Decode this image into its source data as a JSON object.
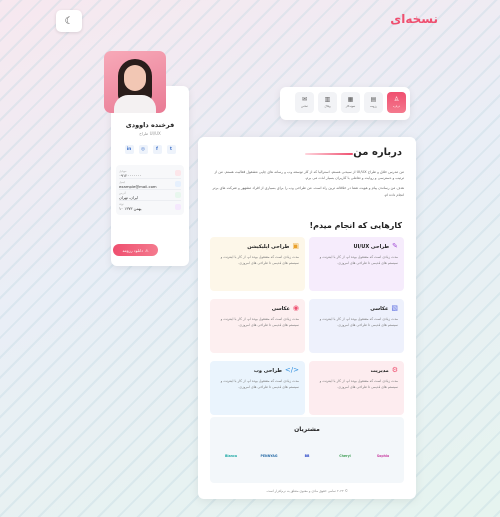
{
  "brand": {
    "logo_text": "نسخه‌ای",
    "accent": "#ef4f6f"
  },
  "theme_toggle": {
    "icon": "moon-icon"
  },
  "profile": {
    "name": "فرخنده داوودی",
    "title": "طراح UI/UX",
    "socials": [
      "in",
      "◎",
      "f",
      "t"
    ],
    "contacts": [
      {
        "label": "موبایل",
        "value": "۰۹۱۲۰۰۰۰۰۰۰"
      },
      {
        "label": "ایمیل",
        "value": "example@mail.com"
      },
      {
        "label": "آدرس",
        "value": "ایران، تهران"
      },
      {
        "label": "تولد",
        "value": "۱۰ بهمن ۱۳۷۳"
      }
    ],
    "download_label": "دانلود رزومه"
  },
  "nav": {
    "tabs": [
      {
        "label": "درباره",
        "icon": "user-icon",
        "active": true
      },
      {
        "label": "رزومه",
        "icon": "file-icon",
        "active": false
      },
      {
        "label": "نمونه‌کار",
        "icon": "briefcase-icon",
        "active": false
      },
      {
        "label": "وبلاگ",
        "icon": "blog-icon",
        "active": false
      },
      {
        "label": "تماس",
        "icon": "mail-icon",
        "active": false
      }
    ]
  },
  "about": {
    "title": "درباره من",
    "paragraphs": [
      "من مدرس خلاق و طراح UI/UX از سیدنی هستم. استرالیا که از کار توسعه وب و رسانه های چاپی مشغول فعالیت هستم. من از ترتیب و دسترسی و روایت و تعاملی با کاربران بسیار لذت می برم.",
      "هدف من رساندن پیام و هویت شما در خلاقانه ترین راه است. من طراحی وب را برای بسیاری از افراد مشهور و شرکت های برتر انجام داده ام."
    ]
  },
  "services": {
    "title": "کارهایی که انجام میدم!",
    "items": [
      {
        "name": "طراحی UI/UX",
        "icon": "✎",
        "bg": "#f6ecfc",
        "color": "#a34fd6",
        "desc": "مدت زیادی است که مشغول بوده ام، از کار با اینترنت و سیستم های قدیمی تا طراحی های امروزی."
      },
      {
        "name": "طراحی اپلیکیشن",
        "icon": "▣",
        "bg": "#fdf7e9",
        "color": "#e9a12b",
        "desc": "مدت زیادی است که مشغول بوده ام، از کار با اینترنت و سیستم های قدیمی تا طراحی های امروزی."
      },
      {
        "name": "عکاسی",
        "icon": "▧",
        "bg": "#eef1fc",
        "color": "#5a6be0",
        "desc": "مدت زیادی است که مشغول بوده ام، از کار با اینترنت و سیستم های قدیمی تا طراحی های امروزی."
      },
      {
        "name": "عکاسی",
        "icon": "◉",
        "bg": "#fdeff0",
        "color": "#ef4f6f",
        "desc": "مدت زیادی است که مشغول بوده ام، از کار با اینترنت و سیستم های قدیمی تا طراحی های امروزی."
      },
      {
        "name": "مدیریت",
        "icon": "⚙",
        "bg": "#fdecef",
        "color": "#ef4f6f",
        "desc": "مدت زیادی است که مشغول بوده ام، از کار با اینترنت و سیستم های قدیمی تا طراحی های امروزی."
      },
      {
        "name": "طراحی وب",
        "icon": "</>",
        "bg": "#eaf4fd",
        "color": "#2f8fe0",
        "desc": "مدت زیادی است که مشغول بوده ام، از کار با اینترنت و سیستم های قدیمی تا طراحی های امروزی."
      }
    ]
  },
  "clients": {
    "title": "مشتریان",
    "logos": [
      {
        "name": "Sophia",
        "color": "#c83fa1"
      },
      {
        "name": "Cheryl",
        "color": "#3f9e55"
      },
      {
        "name": "BB",
        "color": "#2f4bc8"
      },
      {
        "name": "PENNYAG",
        "color": "#2b6ea8"
      },
      {
        "name": "Bianca",
        "color": "#1aa7a3"
      }
    ]
  },
  "footer": {
    "text": "© ۲۰۲۴ تمامی حقوق مادی و معنوی متعلق به نرم‌افزار است."
  }
}
